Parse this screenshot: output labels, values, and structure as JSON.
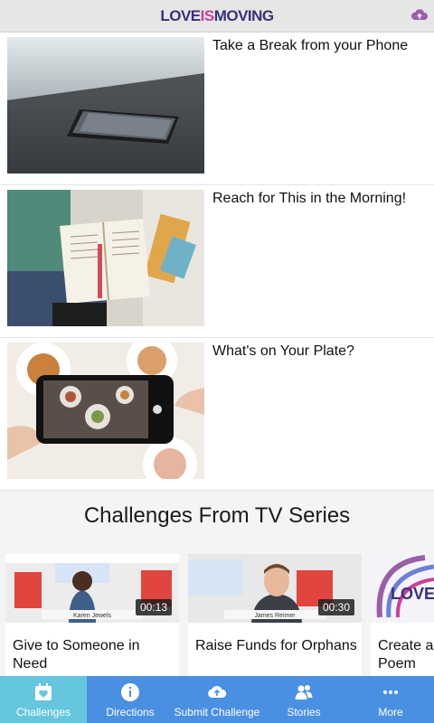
{
  "header": {
    "logo_part1": "LOVE",
    "logo_part2": "IS",
    "logo_part3": "MOVING",
    "upload_icon": "cloud-upload-icon"
  },
  "challenges": [
    {
      "title": "Take a Break from your Phone",
      "image": "phone-on-table"
    },
    {
      "title": "Reach for This in the Morning!",
      "image": "open-bible"
    },
    {
      "title": "What's on Your Plate?",
      "image": "phone-photo-food"
    }
  ],
  "tv_section": {
    "title": "Challenges From TV Series",
    "videos": [
      {
        "title": "Give to Someone in Need",
        "duration": "00:13",
        "lower_third": "Karen Jewels"
      },
      {
        "title": "Raise Funds for Orphans",
        "duration": "00:30",
        "lower_third": "James Reimer"
      },
      {
        "title": "Create a Poem",
        "duration": "",
        "lower_third": ""
      }
    ]
  },
  "tabs": [
    {
      "label": "Challenges",
      "icon": "calendar-heart-icon",
      "active": true
    },
    {
      "label": "Directions",
      "icon": "info-icon",
      "active": false
    },
    {
      "label": "Submit Challenge",
      "icon": "cloud-upload-icon",
      "active": false
    },
    {
      "label": "Stories",
      "icon": "people-icon",
      "active": false
    },
    {
      "label": "More",
      "icon": "more-dots-icon",
      "active": false
    }
  ],
  "colors": {
    "tabbar": "#4a90e2",
    "tab_active": "#65c6de",
    "logo_primary": "#3a2f7a",
    "logo_accent": "#c8409a"
  }
}
